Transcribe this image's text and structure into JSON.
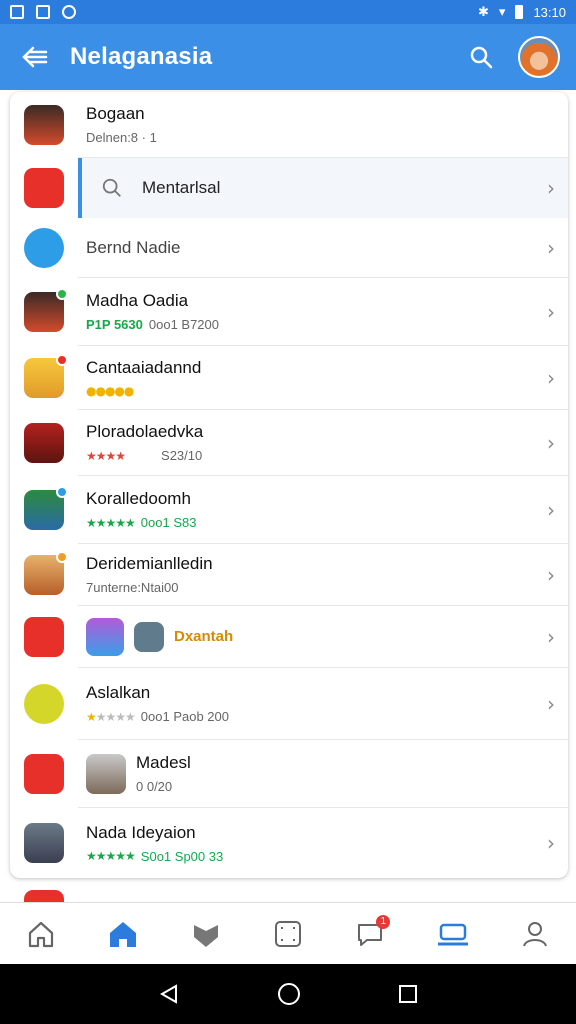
{
  "status_bar": {
    "time": "13:10"
  },
  "app_bar": {
    "title": "Nelaganasia"
  },
  "colors": {
    "primary": "#3c8fe6",
    "status": "#2b7cdc",
    "accent_red": "#e8302b"
  },
  "list": {
    "row0": {
      "title": "Bogaan",
      "sub": "Delnen:8 ·  1"
    },
    "search": {
      "text": "Mentarlsal"
    },
    "row2": {
      "title": "Bernd Nadie"
    },
    "row3": {
      "title": "Madha Oadia",
      "tag": "P1P 5630",
      "meta": "0oo1 B7200"
    },
    "row4": {
      "title": "Cantaaiadannd"
    },
    "row5": {
      "title": "Ploradolaedvka",
      "price": "S23/10"
    },
    "row6": {
      "title": "Koralledoomh",
      "meta": "0oo1 S83"
    },
    "row7": {
      "title": "Deridemianlledin",
      "sub": "7unterne:Ntai00"
    },
    "row8": {
      "label": "Dxantah"
    },
    "row9": {
      "title": "Aslalkan",
      "meta": "0oo1 Paob 200"
    },
    "row10": {
      "title": "Madesl",
      "sub": "0 0/20"
    },
    "row11": {
      "title": "Nada Ideyaion",
      "meta": "S0o1 Sp00 33"
    }
  },
  "icons": {
    "back": "arrow-back-icon",
    "search": "search-icon",
    "nav": [
      "home-outline-icon",
      "home-icon",
      "heart-icon",
      "scan-icon",
      "chat-icon",
      "store-icon",
      "profile-icon"
    ]
  },
  "nav": {
    "chat_badge": "1"
  }
}
